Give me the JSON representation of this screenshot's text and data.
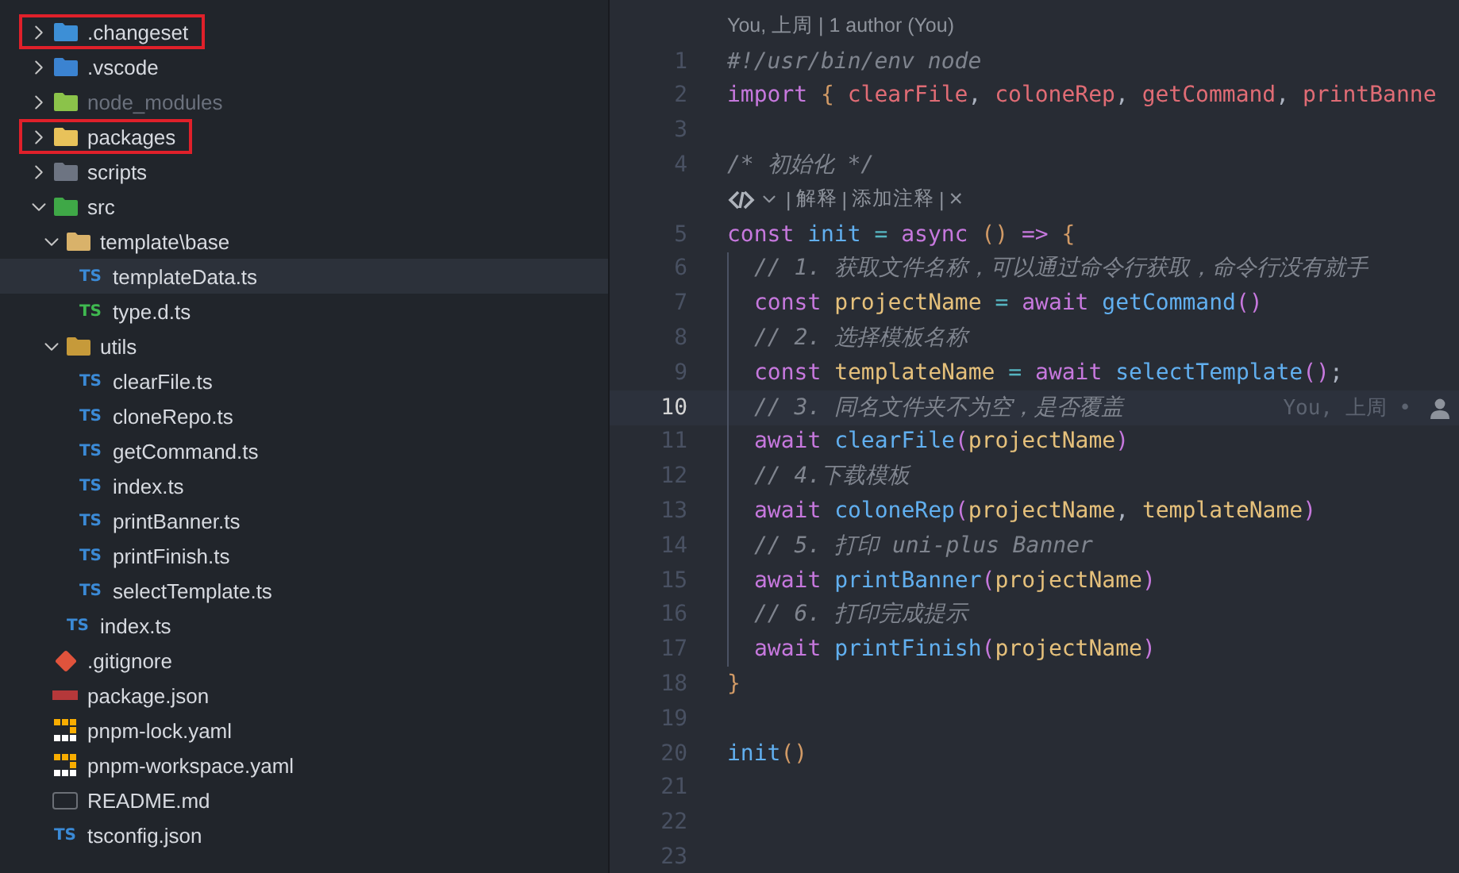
{
  "explorer": {
    "items": [
      {
        "name": ".changeset",
        "kind": "folder",
        "color": "#3d8fd6",
        "expanded": false,
        "selected": false,
        "outlined": true,
        "ignored": false
      },
      {
        "name": ".vscode",
        "kind": "folder",
        "color": "#3b83d1",
        "expanded": false,
        "selected": false,
        "outlined": false,
        "ignored": false
      },
      {
        "name": "node_modules",
        "kind": "folder",
        "color": "#8bc34a",
        "expanded": false,
        "selected": false,
        "outlined": false,
        "ignored": true
      },
      {
        "name": "packages",
        "kind": "folder",
        "color": "#e8c25a",
        "expanded": false,
        "selected": false,
        "outlined": true,
        "ignored": false
      },
      {
        "name": "scripts",
        "kind": "folder",
        "color": "#6d7482",
        "expanded": false,
        "selected": false,
        "outlined": false,
        "ignored": false
      },
      {
        "name": "src",
        "kind": "folder",
        "color": "#3fa847",
        "expanded": true,
        "selected": false,
        "outlined": false,
        "ignored": false,
        "children": [
          {
            "name": "template\\base",
            "kind": "folder",
            "color": "#d9b26a",
            "expanded": true,
            "selected": false,
            "outlined": false,
            "ignored": false,
            "children": [
              {
                "name": "templateData.ts",
                "kind": "ts",
                "badge": "TS",
                "color": "#3b8ad6",
                "selected": true,
                "outlined": false,
                "ignored": false
              },
              {
                "name": "type.d.ts",
                "kind": "ts",
                "badge": "TS",
                "color": "#3fb950",
                "selected": false,
                "outlined": false,
                "ignored": false
              }
            ]
          },
          {
            "name": "utils",
            "kind": "folder",
            "color": "#c69a3a",
            "expanded": true,
            "selected": false,
            "outlined": false,
            "ignored": false,
            "children": [
              {
                "name": "clearFile.ts",
                "kind": "ts",
                "badge": "TS",
                "color": "#3b8ad6",
                "selected": false,
                "outlined": false,
                "ignored": false
              },
              {
                "name": "cloneRepo.ts",
                "kind": "ts",
                "badge": "TS",
                "color": "#3b8ad6",
                "selected": false,
                "outlined": false,
                "ignored": false
              },
              {
                "name": "getCommand.ts",
                "kind": "ts",
                "badge": "TS",
                "color": "#3b8ad6",
                "selected": false,
                "outlined": false,
                "ignored": false
              },
              {
                "name": "index.ts",
                "kind": "ts",
                "badge": "TS",
                "color": "#3b8ad6",
                "selected": false,
                "outlined": false,
                "ignored": false
              },
              {
                "name": "printBanner.ts",
                "kind": "ts",
                "badge": "TS",
                "color": "#3b8ad6",
                "selected": false,
                "outlined": false,
                "ignored": false
              },
              {
                "name": "printFinish.ts",
                "kind": "ts",
                "badge": "TS",
                "color": "#3b8ad6",
                "selected": false,
                "outlined": false,
                "ignored": false
              },
              {
                "name": "selectTemplate.ts",
                "kind": "ts",
                "badge": "TS",
                "color": "#3b8ad6",
                "selected": false,
                "outlined": false,
                "ignored": false
              }
            ]
          },
          {
            "name": "index.ts",
            "kind": "ts",
            "badge": "TS",
            "color": "#3b8ad6",
            "selected": false,
            "outlined": false,
            "ignored": false
          }
        ]
      },
      {
        "name": ".gitignore",
        "kind": "git",
        "selected": false,
        "outlined": false,
        "ignored": false
      },
      {
        "name": "package.json",
        "kind": "npm",
        "selected": false,
        "outlined": false,
        "ignored": false
      },
      {
        "name": "pnpm-lock.yaml",
        "kind": "pnpm",
        "selected": false,
        "outlined": false,
        "ignored": false
      },
      {
        "name": "pnpm-workspace.yaml",
        "kind": "pnpm",
        "selected": false,
        "outlined": false,
        "ignored": false
      },
      {
        "name": "README.md",
        "kind": "md",
        "selected": false,
        "outlined": false,
        "ignored": false
      },
      {
        "name": "tsconfig.json",
        "kind": "ts",
        "badge": "TS",
        "color": "#3b8ad6",
        "selected": false,
        "outlined": false,
        "ignored": false
      }
    ]
  },
  "editor": {
    "rows": [
      {
        "kind": "blame-lens",
        "text": "You, 上周 | 1 author (You)"
      },
      {
        "kind": "line",
        "n": "1",
        "current": false,
        "indented": false,
        "tokens": [
          {
            "t": "#!/usr/bin/env node",
            "kind": "comment"
          }
        ]
      },
      {
        "kind": "line",
        "n": "2",
        "current": false,
        "indented": false,
        "tokens": [
          {
            "t": "import ",
            "kind": "keyword"
          },
          {
            "t": "{ ",
            "kind": "brace"
          },
          {
            "t": "clearFile",
            "kind": "import"
          },
          {
            "t": ", ",
            "kind": "plain"
          },
          {
            "t": "coloneRep",
            "kind": "import"
          },
          {
            "t": ", ",
            "kind": "plain"
          },
          {
            "t": "getCommand",
            "kind": "import"
          },
          {
            "t": ", ",
            "kind": "plain"
          },
          {
            "t": "printBanne",
            "kind": "import"
          }
        ]
      },
      {
        "kind": "line",
        "n": "3",
        "current": false,
        "tokens": []
      },
      {
        "kind": "line",
        "n": "4",
        "current": false,
        "indented": false,
        "tokens": [
          {
            "t": "/* 初始化 */",
            "kind": "comment"
          }
        ]
      },
      {
        "kind": "ai-lens",
        "items": [
          {
            "kind": "sep",
            "text": "|"
          },
          {
            "kind": "action",
            "text": "解释"
          },
          {
            "kind": "sep",
            "text": "|"
          },
          {
            "kind": "action",
            "text": "添加注释"
          },
          {
            "kind": "sep",
            "text": "|"
          },
          {
            "kind": "close",
            "text": "×"
          }
        ]
      },
      {
        "kind": "line",
        "n": "5",
        "current": false,
        "indented": false,
        "tokens": [
          {
            "t": "const ",
            "kind": "keyword"
          },
          {
            "t": "init ",
            "kind": "function"
          },
          {
            "t": "= ",
            "kind": "operator"
          },
          {
            "t": "async ",
            "kind": "keyword"
          },
          {
            "t": "() ",
            "kind": "brace"
          },
          {
            "t": "=> ",
            "kind": "keyword"
          },
          {
            "t": "{",
            "kind": "brace"
          }
        ]
      },
      {
        "kind": "line",
        "n": "6",
        "current": false,
        "indented": true,
        "tokens": [
          {
            "t": "// 1. 获取文件名称，可以通过命令行获取，命令行没有就手",
            "kind": "comment"
          }
        ]
      },
      {
        "kind": "line",
        "n": "7",
        "current": false,
        "indented": true,
        "tokens": [
          {
            "t": "const ",
            "kind": "keyword"
          },
          {
            "t": "projectName ",
            "kind": "variable"
          },
          {
            "t": "= ",
            "kind": "operator"
          },
          {
            "t": "await ",
            "kind": "keyword"
          },
          {
            "t": "getCommand",
            "kind": "function"
          },
          {
            "t": "()",
            "kind": "paren"
          }
        ]
      },
      {
        "kind": "line",
        "n": "8",
        "current": false,
        "indented": true,
        "tokens": [
          {
            "t": "// 2. 选择模板名称",
            "kind": "comment"
          }
        ]
      },
      {
        "kind": "line",
        "n": "9",
        "current": false,
        "indented": true,
        "tokens": [
          {
            "t": "const ",
            "kind": "keyword"
          },
          {
            "t": "templateName ",
            "kind": "variable"
          },
          {
            "t": "= ",
            "kind": "operator"
          },
          {
            "t": "await ",
            "kind": "keyword"
          },
          {
            "t": "selectTemplate",
            "kind": "function"
          },
          {
            "t": "()",
            "kind": "paren"
          },
          {
            "t": ";",
            "kind": "plain"
          }
        ]
      },
      {
        "kind": "line",
        "n": "10",
        "current": true,
        "indented": true,
        "blame": "You, 上周 •",
        "tokens": [
          {
            "t": "// 3. 同名文件夹不为空，是否覆盖",
            "kind": "comment"
          }
        ]
      },
      {
        "kind": "line",
        "n": "11",
        "current": false,
        "indented": true,
        "tokens": [
          {
            "t": "await ",
            "kind": "keyword"
          },
          {
            "t": "clearFile",
            "kind": "function"
          },
          {
            "t": "(",
            "kind": "paren"
          },
          {
            "t": "projectName",
            "kind": "variable"
          },
          {
            "t": ")",
            "kind": "paren"
          }
        ]
      },
      {
        "kind": "line",
        "n": "12",
        "current": false,
        "indented": true,
        "tokens": [
          {
            "t": "// 4.下载模板",
            "kind": "comment"
          }
        ]
      },
      {
        "kind": "line",
        "n": "13",
        "current": false,
        "indented": true,
        "tokens": [
          {
            "t": "await ",
            "kind": "keyword"
          },
          {
            "t": "coloneRep",
            "kind": "function"
          },
          {
            "t": "(",
            "kind": "paren"
          },
          {
            "t": "projectName",
            "kind": "variable"
          },
          {
            "t": ", ",
            "kind": "plain"
          },
          {
            "t": "templateName",
            "kind": "variable"
          },
          {
            "t": ")",
            "kind": "paren"
          }
        ]
      },
      {
        "kind": "line",
        "n": "14",
        "current": false,
        "indented": true,
        "tokens": [
          {
            "t": "// 5. 打印 uni-plus Banner",
            "kind": "comment"
          }
        ]
      },
      {
        "kind": "line",
        "n": "15",
        "current": false,
        "indented": true,
        "tokens": [
          {
            "t": "await ",
            "kind": "keyword"
          },
          {
            "t": "printBanner",
            "kind": "function"
          },
          {
            "t": "(",
            "kind": "paren"
          },
          {
            "t": "projectName",
            "kind": "variable"
          },
          {
            "t": ")",
            "kind": "paren"
          }
        ]
      },
      {
        "kind": "line",
        "n": "16",
        "current": false,
        "indented": true,
        "tokens": [
          {
            "t": "// 6. 打印完成提示",
            "kind": "comment"
          }
        ]
      },
      {
        "kind": "line",
        "n": "17",
        "current": false,
        "indented": true,
        "tokens": [
          {
            "t": "await ",
            "kind": "keyword"
          },
          {
            "t": "printFinish",
            "kind": "function"
          },
          {
            "t": "(",
            "kind": "paren"
          },
          {
            "t": "projectName",
            "kind": "variable"
          },
          {
            "t": ")",
            "kind": "paren"
          }
        ]
      },
      {
        "kind": "line",
        "n": "18",
        "current": false,
        "indented": false,
        "tokens": [
          {
            "t": "}",
            "kind": "brace"
          }
        ]
      },
      {
        "kind": "line",
        "n": "19",
        "current": false,
        "tokens": []
      },
      {
        "kind": "line",
        "n": "20",
        "current": false,
        "indented": false,
        "tokens": [
          {
            "t": "init",
            "kind": "function"
          },
          {
            "t": "()",
            "kind": "brace"
          }
        ]
      },
      {
        "kind": "line",
        "n": "21",
        "current": false,
        "tokens": []
      },
      {
        "kind": "line",
        "n": "22",
        "current": false,
        "tokens": []
      },
      {
        "kind": "line",
        "n": "23",
        "current": false,
        "tokens": []
      }
    ]
  }
}
